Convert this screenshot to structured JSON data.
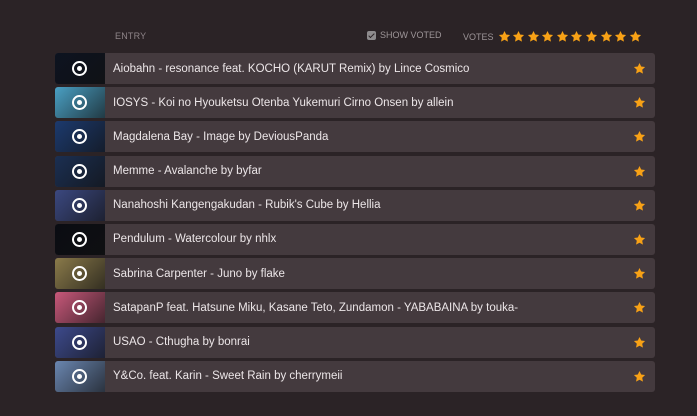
{
  "header": {
    "entry_label": "ENTRY",
    "show_voted_label": "SHOW VOTED",
    "show_voted_checked": true,
    "votes_label": "VOTES",
    "votes_star_count": 10
  },
  "colors": {
    "star": "#f7a116",
    "row_bg": "#443a3e",
    "page_bg": "#2b2326"
  },
  "entries": [
    {
      "title": "Aiobahn - resonance feat. KOCHO (KARUT Remix) by Lince Cosmico",
      "thumb": "#0d1320"
    },
    {
      "title": "IOSYS - Koi no Hyouketsu Otenba Yukemuri Cirno Onsen by allein",
      "thumb": "#4aa0c4"
    },
    {
      "title": "Magdalena Bay - Image by DeviousPanda",
      "thumb": "#1c3a6e"
    },
    {
      "title": "Memme - Avalanche by byfar",
      "thumb": "#1b2f52"
    },
    {
      "title": "Nanahoshi Kangengakudan - Rubik's Cube by Hellia",
      "thumb": "#3b4880"
    },
    {
      "title": "Pendulum - Watercolour by nhlx",
      "thumb": "#0a0c12"
    },
    {
      "title": "Sabrina Carpenter - Juno by flake",
      "thumb": "#8a7a4a"
    },
    {
      "title": "SatapanP feat. Hatsune Miku, Kasane Teto, Zundamon - YABABAINA by touka-",
      "thumb": "#c8587a"
    },
    {
      "title": "USAO - Cthugha by bonrai",
      "thumb": "#3d4a8c"
    },
    {
      "title": "Y&Co. feat. Karin - Sweet Rain by cherrymeii",
      "thumb": "#6a86b0"
    }
  ]
}
